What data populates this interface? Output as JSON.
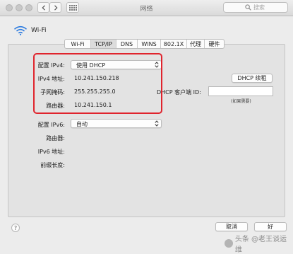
{
  "window": {
    "title": "网络"
  },
  "search": {
    "placeholder": "搜索"
  },
  "header": {
    "interface_name": "Wi-Fi"
  },
  "tabs": [
    {
      "label": "Wi-Fi"
    },
    {
      "label": "TCP/IP",
      "selected": true
    },
    {
      "label": "DNS"
    },
    {
      "label": "WINS"
    },
    {
      "label": "802.1X"
    },
    {
      "label": "代理"
    },
    {
      "label": "硬件"
    }
  ],
  "ipv4": {
    "config_label": "配置 IPv4:",
    "config_value": "使用 DHCP",
    "address_label": "IPv4 地址:",
    "address_value": "10.241.150.218",
    "subnet_label": "子网掩码:",
    "subnet_value": "255.255.255.0",
    "router_label": "路由器:",
    "router_value": "10.241.150.1",
    "renew_button": "DHCP 续租",
    "client_id_label": "DHCP 客户端 ID:",
    "client_id_value": "",
    "client_id_hint": "(如果需要)"
  },
  "ipv6": {
    "config_label": "配置 IPv6:",
    "config_value": "自动",
    "router_label": "路由器:",
    "address_label": "IPv6 地址:",
    "prefix_label": "前缀长度:"
  },
  "footer": {
    "cancel": "取消",
    "ok": "好",
    "help": "?"
  },
  "watermark": {
    "text": "头条 @老王谈运维"
  },
  "colors": {
    "highlight_box": "#e0242d",
    "panel_bg": "#e3e3e3",
    "window_bg": "#ececec"
  }
}
